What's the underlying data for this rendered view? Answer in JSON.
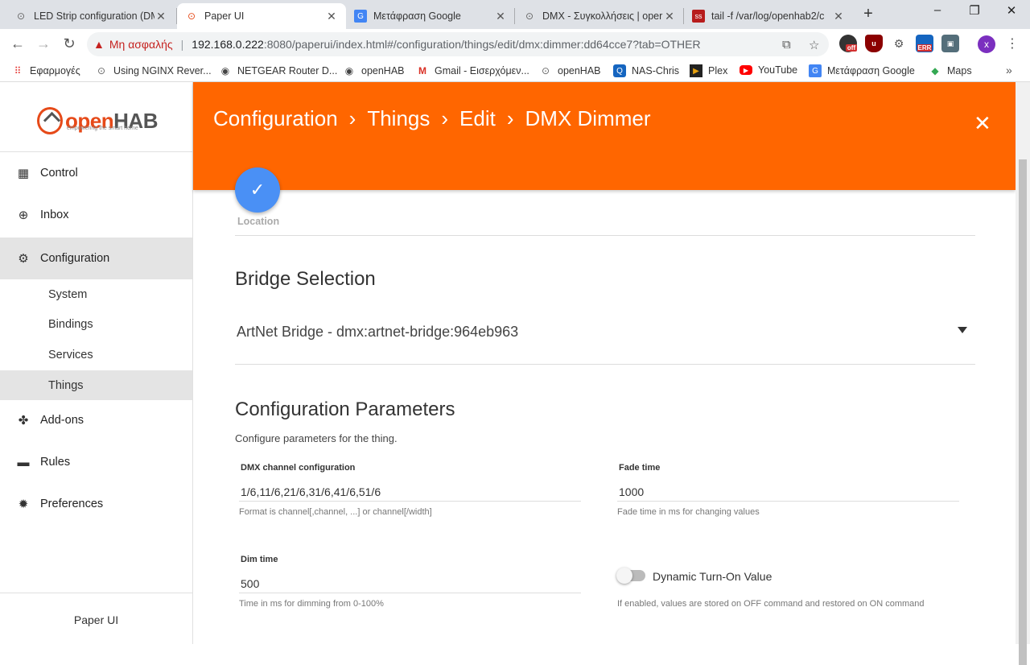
{
  "browser": {
    "tabs": [
      {
        "title": "LED Strip configuration (DM",
        "icon": "openhab-icon"
      },
      {
        "title": "Paper UI",
        "icon": "openhab-icon",
        "active": true
      },
      {
        "title": "Μετάφραση Google",
        "icon": "google-translate-icon"
      },
      {
        "title": "DMX - Συγκολλήσεις | oper",
        "icon": "openhab-icon"
      },
      {
        "title": "tail -f /var/log/openhab2/c",
        "icon": "terminal-icon"
      }
    ],
    "new_tab": "+",
    "window_controls": {
      "minimize": "–",
      "restore": "❐",
      "close": "✕"
    },
    "address": {
      "security_label": "Μη ασφαλής",
      "host": "192.168.0.222",
      "path": ":8080/paperui/index.html#/configuration/things/edit/dmx:dimmer:dd64cce7?tab=OTHER"
    },
    "extensions": {
      "off_badge": "off",
      "err_badge": "ERR",
      "profile_initial": "x"
    },
    "bookmarks": [
      {
        "label": "Εφαρμογές",
        "icon": "apps-grid-icon"
      },
      {
        "label": "Using NGINX Rever...",
        "icon": "openhab-icon"
      },
      {
        "label": "NETGEAR Router D...",
        "icon": "globe-icon"
      },
      {
        "label": "openHAB",
        "icon": "globe-icon"
      },
      {
        "label": "Gmail - Εισερχόμεν...",
        "icon": "gmail-icon"
      },
      {
        "label": "openHAB",
        "icon": "openhab-icon"
      },
      {
        "label": "NAS-Chris",
        "icon": "nas-icon"
      },
      {
        "label": "Plex",
        "icon": "plex-icon"
      },
      {
        "label": "YouTube",
        "icon": "youtube-icon"
      },
      {
        "label": "Μετάφραση Google",
        "icon": "google-translate-icon"
      },
      {
        "label": "Maps",
        "icon": "maps-icon"
      }
    ],
    "bookmarks_more": "»"
  },
  "sidebar": {
    "logo_text_o": "open",
    "logo_text_h": "HAB",
    "logo_tagline": "empowering the smart home",
    "items": [
      {
        "label": "Control",
        "icon": "dashboard-icon"
      },
      {
        "label": "Inbox",
        "icon": "plus-circle-icon"
      },
      {
        "label": "Configuration",
        "icon": "gear-icon",
        "selected": true
      },
      {
        "label": "Add-ons",
        "icon": "puzzle-icon"
      },
      {
        "label": "Rules",
        "icon": "clapperboard-icon"
      },
      {
        "label": "Preferences",
        "icon": "settings-icon"
      }
    ],
    "sub_items": [
      {
        "label": "System"
      },
      {
        "label": "Bindings"
      },
      {
        "label": "Services"
      },
      {
        "label": "Things",
        "selected": true
      }
    ],
    "footer": "Paper UI"
  },
  "header": {
    "breadcrumbs": [
      "Configuration",
      "Things",
      "Edit",
      "DMX Dimmer"
    ],
    "separator": "›",
    "close": "✕"
  },
  "content": {
    "location_label": "Location",
    "bridge_title": "Bridge Selection",
    "bridge_value": "ArtNet Bridge - dmx:artnet-bridge:964eb963",
    "params_title": "Configuration Parameters",
    "params_description": "Configure parameters for the thing.",
    "fields": {
      "dmx_channel": {
        "label": "DMX channel configuration",
        "value": "1/6,11/6,21/6,31/6,41/6,51/6",
        "help": "Format is channel[,channel, ...] or channel[/width]"
      },
      "fade_time": {
        "label": "Fade time",
        "value": "1000",
        "help": "Fade time in ms for changing values"
      },
      "dim_time": {
        "label": "Dim time",
        "value": "500",
        "help": "Time in ms for dimming from 0-100%"
      },
      "dynamic_turn_on": {
        "label": "Dynamic Turn-On Value",
        "enabled": false,
        "help": "If enabled, values are stored on OFF command and restored on ON command"
      }
    }
  },
  "colors": {
    "header": "#ff6600",
    "fab": "#4a90f5",
    "selected_nav": "#e4e4e4",
    "insecure": "#c5221f"
  }
}
